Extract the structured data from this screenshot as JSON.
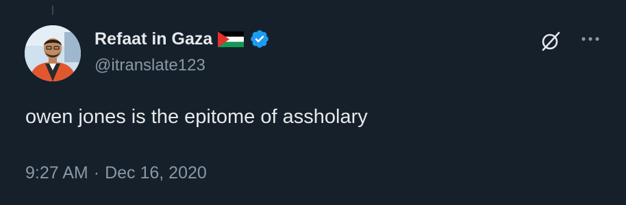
{
  "tweet": {
    "author": {
      "display_name": "Refaat in Gaza",
      "handle": "@itranslate123",
      "flag_icon": "palestine-flag-icon",
      "verified_icon": "verified-badge-icon",
      "verified_color": "#1d9bf0"
    },
    "text": "owen jones is the epitome of assholary",
    "time": "9:27 AM",
    "separator": "·",
    "date": "Dec 16, 2020"
  },
  "actions": {
    "grok_icon": "grok-icon",
    "more_icon": "more-options-icon"
  },
  "colors": {
    "background": "#15202b",
    "primary_text": "#e7e9ea",
    "secondary_text": "#8b98a5"
  }
}
